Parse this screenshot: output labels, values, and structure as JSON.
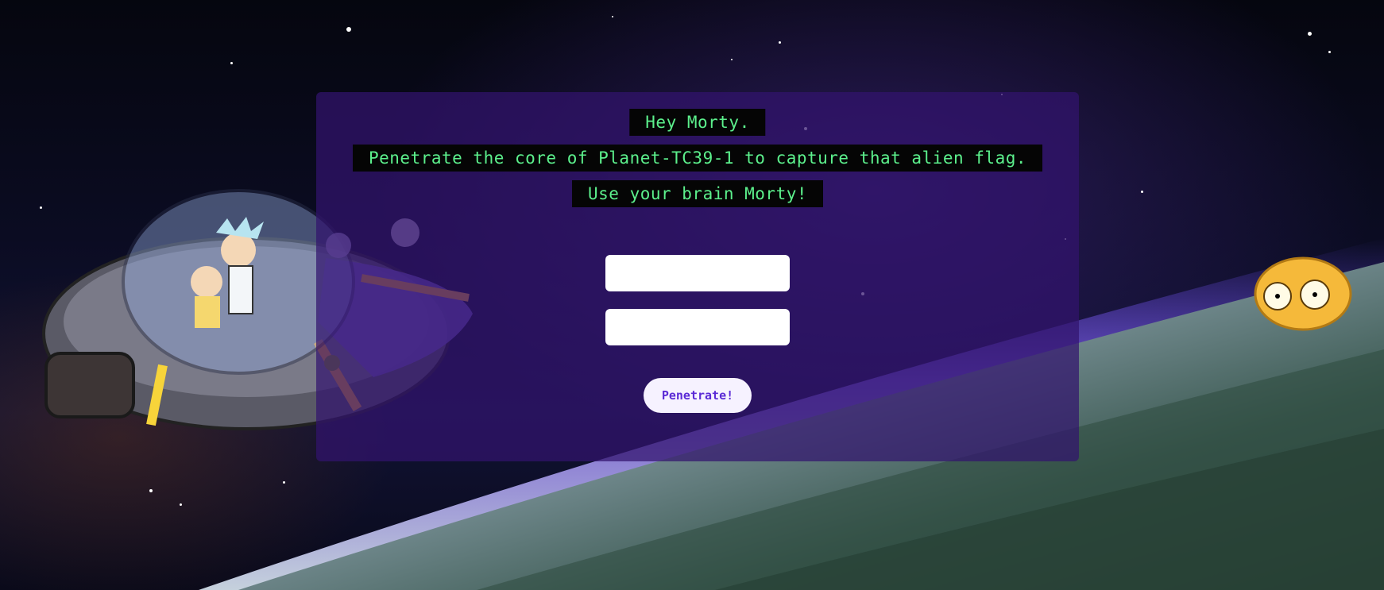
{
  "messages": {
    "line1": "Hey Morty.",
    "line2": "Penetrate the core of Planet-TC39-1 to capture that alien flag.",
    "line3": "Use your brain Morty!"
  },
  "form": {
    "field1_value": "",
    "field2_value": "",
    "submit_label": "Penetrate!"
  },
  "colors": {
    "panel": "#321470",
    "message_text": "#5cf08c",
    "message_bg": "#050505",
    "button_text": "#5b2bd6"
  }
}
